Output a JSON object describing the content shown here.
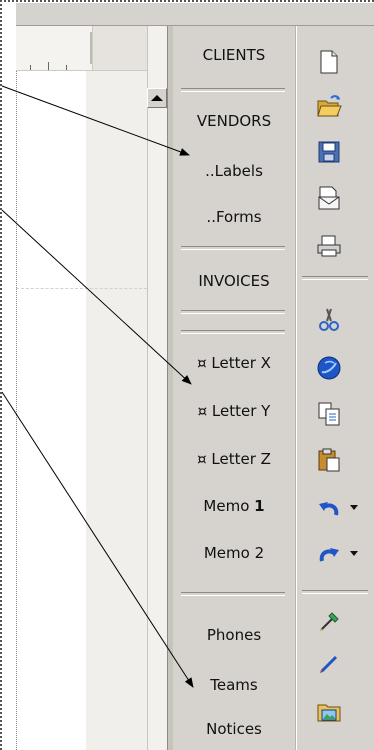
{
  "menu": {
    "clients": "CLIENTS",
    "vendors": "VENDORS",
    "labels": "..Labels",
    "forms": "..Forms",
    "invoices": "INVOICES",
    "letter_x": "¤ Letter X",
    "letter_y": "¤ Letter Y",
    "letter_z": "¤ Letter Z",
    "memo1_text": "Memo ",
    "memo1_num": "1",
    "memo2": "Memo 2",
    "phones": "Phones",
    "teams": "Teams",
    "notices": "Notices"
  },
  "toolbar": [
    "new-document",
    "open-folder",
    "save",
    "mail",
    "print",
    "cut",
    "web",
    "copy",
    "paste",
    "undo",
    "redo",
    "format-painter",
    "draw",
    "insert-picture"
  ]
}
